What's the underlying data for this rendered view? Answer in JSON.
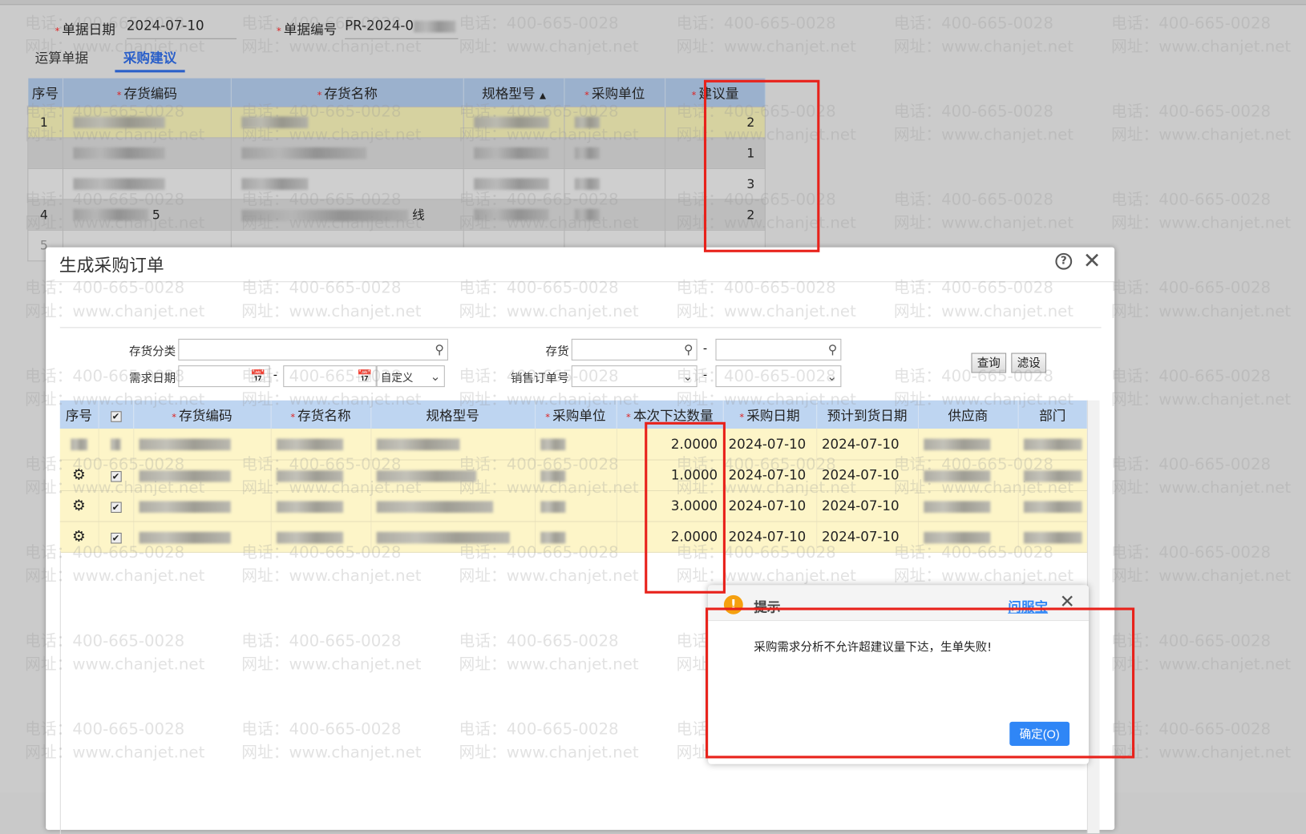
{
  "watermark": {
    "phone": "电话：400-665-0028",
    "site": "网址：www.chanjet.net"
  },
  "header": {
    "date_label": "单据日期",
    "date_value": "2024-07-10",
    "code_label": "单据编号",
    "code_value": "PR-2024-0"
  },
  "tabs": [
    {
      "label": "运算单据"
    },
    {
      "label": "采购建议"
    }
  ],
  "bg_table": {
    "columns": [
      "序号",
      "存货编码",
      "存货名称",
      "规格型号",
      "采购单位",
      "建议量"
    ],
    "rows": [
      {
        "no": "1",
        "qty": "2"
      },
      {
        "no": "",
        "qty": "1"
      },
      {
        "no": "",
        "qty": "3"
      },
      {
        "no": "4",
        "qty": "2",
        "name_tail": "线",
        "code_tail": "5"
      },
      {
        "no": "5",
        "qty": ""
      }
    ]
  },
  "modal": {
    "title": "生成采购订单",
    "filters": {
      "category": "存货分类",
      "inventory": "存货",
      "demand_date": "需求日期",
      "range_select": "自定义",
      "sales_order": "销售订单号",
      "dash": "-"
    },
    "buttons": {
      "query": "查询",
      "filter": "滤设"
    },
    "grid": {
      "columns": [
        "序号",
        "",
        "存货编码",
        "存货名称",
        "规格型号",
        "采购单位",
        "本次下达数量",
        "采购日期",
        "预计到货日期",
        "供应商",
        "部门"
      ],
      "rows": [
        {
          "qty": "2.0000",
          "pdate": "2024-07-10",
          "adate": "2024-07-10"
        },
        {
          "qty": "1.0000",
          "pdate": "2024-07-10",
          "adate": "2024-07-10"
        },
        {
          "qty": "3.0000",
          "pdate": "2024-07-10",
          "adate": "2024-07-10"
        },
        {
          "qty": "2.0000",
          "pdate": "2024-07-10",
          "adate": "2024-07-10"
        }
      ]
    }
  },
  "prompt": {
    "title": "提示",
    "help_link": "问服宝",
    "message": "采购需求分析不允许超建议量下达，生单失败!",
    "ok": "确定(O)"
  },
  "colors": {
    "accent": "#2f86f6",
    "highlight": "#e8221b",
    "warning": "#f5a00f"
  }
}
